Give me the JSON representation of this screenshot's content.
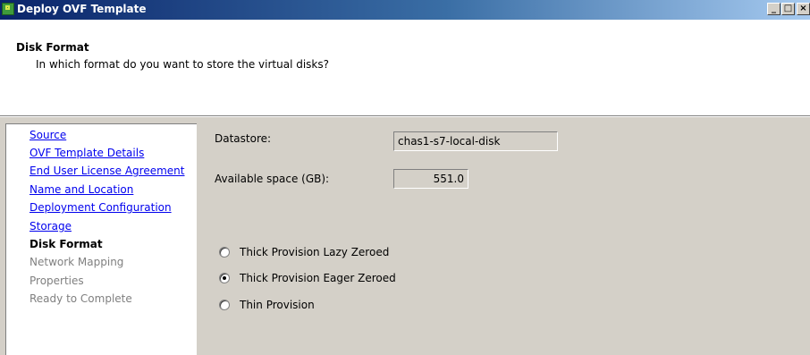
{
  "window": {
    "title": "Deploy OVF Template",
    "minimize_label": "_",
    "maximize_label": "□",
    "close_label": "×"
  },
  "header": {
    "title": "Disk Format",
    "subtitle": "In which format do you want to store the virtual disks?"
  },
  "nav": {
    "items": [
      {
        "label": "Source",
        "state": "link"
      },
      {
        "label": "OVF Template Details",
        "state": "link"
      },
      {
        "label": "End User License Agreement",
        "state": "link"
      },
      {
        "label": "Name and Location",
        "state": "link"
      },
      {
        "label": "Deployment Configuration",
        "state": "link"
      },
      {
        "label": "Storage",
        "state": "link"
      },
      {
        "label": "Disk Format",
        "state": "current"
      },
      {
        "label": "Network Mapping",
        "state": "disabled"
      },
      {
        "label": "Properties",
        "state": "disabled"
      },
      {
        "label": "Ready to Complete",
        "state": "disabled"
      }
    ]
  },
  "main": {
    "datastore_label": "Datastore:",
    "datastore_value": "chas1-s7-local-disk",
    "space_label": "Available space (GB):",
    "space_value": "551.0",
    "options": [
      {
        "label": "Thick Provision Lazy Zeroed",
        "checked": false
      },
      {
        "label": "Thick Provision Eager Zeroed",
        "checked": true
      },
      {
        "label": "Thin Provision",
        "checked": false
      }
    ]
  },
  "colors": {
    "link": "#0000ee",
    "disabled": "#808080",
    "titlebar_start": "#0a246a",
    "titlebar_end": "#a6caf0"
  }
}
